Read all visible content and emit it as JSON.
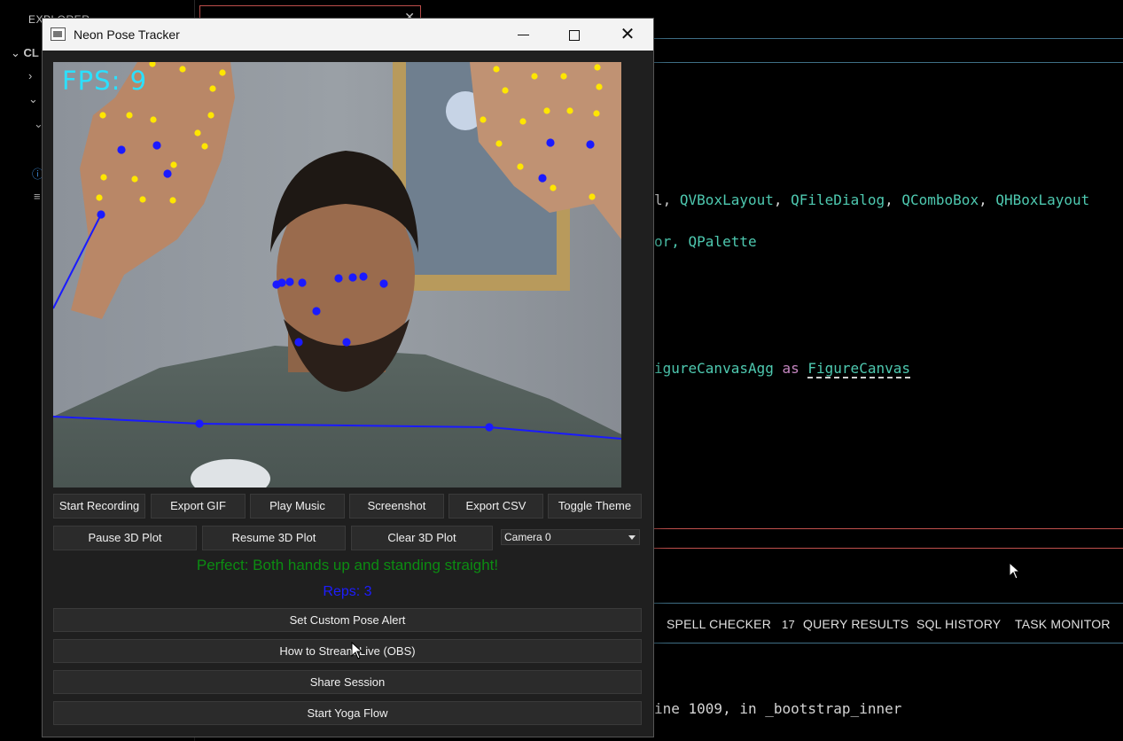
{
  "ide": {
    "explorer_title": "EXPLORER",
    "section_label": "CL",
    "code_lines": [
      {
        "a": "l, ",
        "b": "QVBoxLayout",
        "c": ", ",
        "d": "QFileDialog",
        "e": ", ",
        "f": "QComboBox",
        "g": ", ",
        "h": "QHBoxLayout"
      },
      {
        "a": "or, ",
        "b": "QPalette"
      },
      {
        "a": "igureCanvasAgg",
        "kw": " as ",
        "b": "FigureCanvas"
      }
    ],
    "traceback_line": "ine 1009, in _bootstrap_inner",
    "panel_tabs": [
      {
        "label": "SPELL CHECKER",
        "count": "17"
      },
      {
        "label": "QUERY RESULTS"
      },
      {
        "label": "SQL HISTORY"
      },
      {
        "label": "TASK MONITOR"
      }
    ]
  },
  "window": {
    "title": "Neon Pose Tracker",
    "minimize_icon": "minimize-icon",
    "maximize_icon": "maximize-icon",
    "close_icon": "close-icon"
  },
  "video": {
    "fps_label": "FPS: 9"
  },
  "toolbar_row1": [
    "Start Recording",
    "Export GIF",
    "Play Music",
    "Screenshot",
    "Export CSV",
    "Toggle Theme"
  ],
  "toolbar_row2": [
    "Pause 3D Plot",
    "Resume 3D Plot",
    "Clear 3D Plot"
  ],
  "camera_select": {
    "value": "Camera 0"
  },
  "feedback_text": "Perfect: Both hands up and standing straight!",
  "reps_text": "Reps: 3",
  "wide_buttons": [
    "Set Custom Pose Alert",
    "How to Stream Live (OBS)",
    "Share Session",
    "Start Yoga Flow"
  ],
  "colors": {
    "feedback": "#0c8c12",
    "reps": "#1d1dff",
    "fps": "#2be0ff",
    "landmark_yellow": "#ffe600",
    "landmark_blue": "#1a1aff"
  }
}
